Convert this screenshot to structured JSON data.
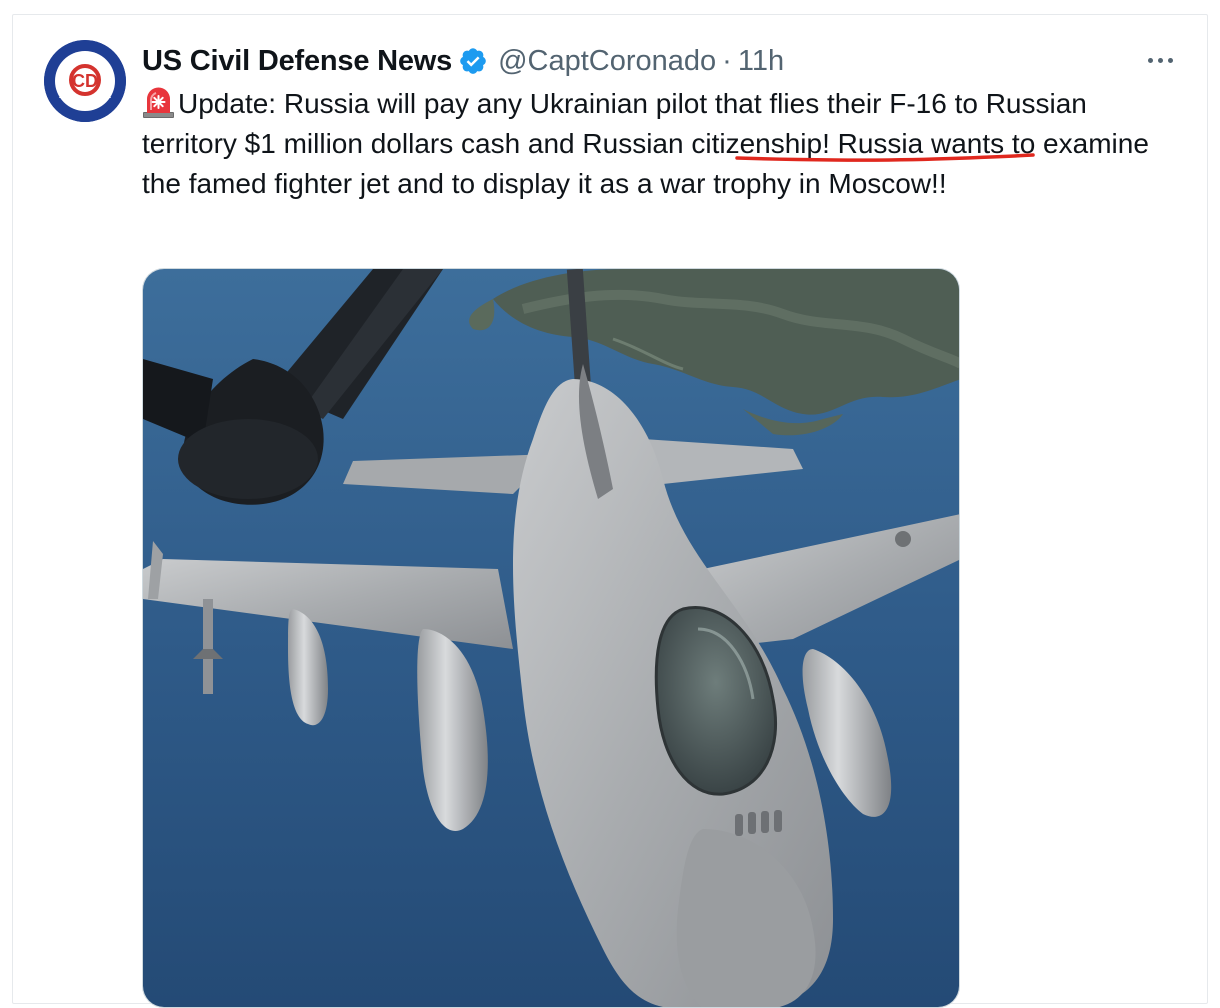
{
  "tweet": {
    "author": {
      "display_name": "US Civil Defense News",
      "handle": "@CaptCoronado",
      "verified": true,
      "avatar_icon": "civil-defense-logo-icon",
      "avatar_text": "CD"
    },
    "separator": "·",
    "time": "11h",
    "more_icon": "more-horizontal-icon",
    "text_emoji": "siren-emoji-icon",
    "text": "Update: Russia will pay any Ukrainian pilot that flies their F-16 to Russian territory $1 million dollars cash and Russian citizenship! Russia wants to examine the famed fighter jet and to display it as a war trophy in Moscow!!",
    "highlight_annotation": "red-underline",
    "media": {
      "type": "photo",
      "icon": "f16-fighter-jet-refueling-photo"
    }
  },
  "colors": {
    "text": "#0f1419",
    "secondary": "#536471",
    "verified": "#1d9bf0",
    "annotation": "#e0281e",
    "avatar": "#1d3b8f",
    "sea": "#335e8c"
  }
}
